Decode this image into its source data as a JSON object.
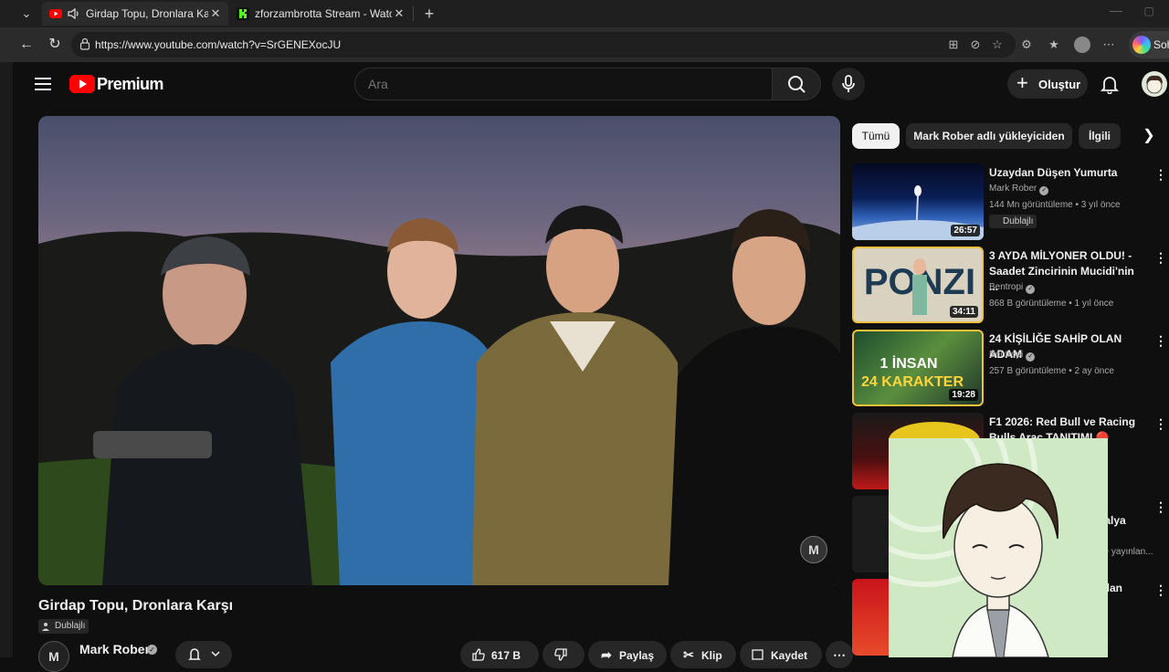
{
  "browser": {
    "tabs": [
      {
        "title": "Girdap Topu, Dronlara Karşı -",
        "active": true
      },
      {
        "title": "zforzambrotta Stream - Watch Live",
        "active": false
      }
    ],
    "url": "https://www.youtube.com/watch?v=SrGENEXocJU",
    "copilot_label": "Soh"
  },
  "masthead": {
    "brand": "Premium",
    "search_placeholder": "Ara",
    "create_label": "Oluştur"
  },
  "video": {
    "title": "Girdap Topu, Dronlara Karşı",
    "dub_label": "Dublajlı",
    "channel": "Mark Rober",
    "channel_avatar": "M",
    "actions": {
      "likes": "617 B",
      "share": "Paylaş",
      "clip": "Klip",
      "save": "Kaydet"
    }
  },
  "chips": {
    "items": [
      "Tümü",
      "Mark Rober adlı yükleyiciden",
      "İlgili"
    ]
  },
  "recommendations": [
    {
      "title": "Uzaydan Düşen Yumurta",
      "channel": "Mark Rober",
      "meta": "144 Mn görüntüleme • 3 yıl önce",
      "duration": "26:57",
      "dub": "Dublajlı"
    },
    {
      "title": "3 AYDA MİLYONER OLDU! - Saadet Zincirinin Mucidi'nin ...",
      "channel": "Bentropi",
      "meta": "868 B görüntüleme • 1 yıl önce",
      "duration": "34:11",
      "thumb_text": "PONZI"
    },
    {
      "title": "24 KİŞİLİĞE SAHİP OLAN ADAM",
      "channel": "Bentropi",
      "meta": "257 B görüntüleme • 2 ay önce",
      "duration": "19:28",
      "thumb_text_1": "1 İNSAN",
      "thumb_text_2": "24 KARAKTER"
    },
    {
      "title": "F1 2026: Red Bull ve Racing Bulls Araç TANITIMI 🔴 CANL..."
    },
    {
      "partial_title_1": "i",
      "partial_title_2": "ntalya",
      "partial_meta": "nce yayınlan..."
    },
    {
      "partial_title_1": "Alan",
      "partial_meta": "e"
    }
  ]
}
